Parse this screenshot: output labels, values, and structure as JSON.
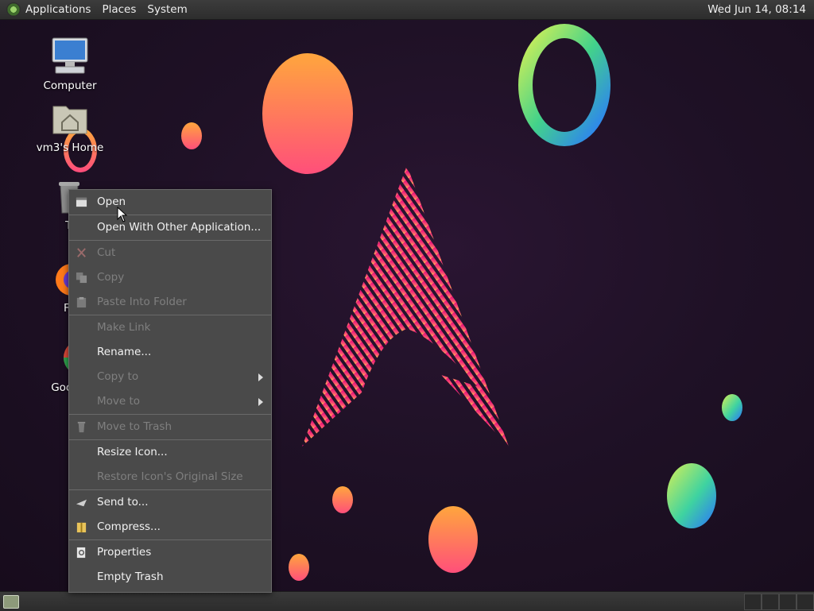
{
  "top_panel": {
    "menus": [
      "Applications",
      "Places",
      "System"
    ],
    "clock": "Wed Jun 14, 08:14"
  },
  "desktop_icons": [
    {
      "label": "Computer",
      "icon": "computer-icon"
    },
    {
      "label": "vm3's Home",
      "icon": "home-folder-icon"
    },
    {
      "label": "Trash",
      "icon": "trash-icon",
      "visible_label": "Tr"
    },
    {
      "label": "Firefox",
      "icon": "firefox-icon",
      "visible_label": "Fir"
    },
    {
      "label": "Google Chrome",
      "icon": "chrome-icon",
      "visible_label": "Google"
    }
  ],
  "context_menu": {
    "items": [
      {
        "label": "Open",
        "enabled": true,
        "icon": "open-icon"
      },
      {
        "label": "Open With Other Application...",
        "enabled": true
      },
      {
        "label": "Cut",
        "enabled": false,
        "icon": "cut-icon"
      },
      {
        "label": "Copy",
        "enabled": false,
        "icon": "copy-icon"
      },
      {
        "label": "Paste Into Folder",
        "enabled": false,
        "icon": "paste-icon"
      },
      {
        "label": "Make Link",
        "enabled": false
      },
      {
        "label": "Rename...",
        "enabled": true
      },
      {
        "label": "Copy to",
        "enabled": false,
        "submenu": true
      },
      {
        "label": "Move to",
        "enabled": false,
        "submenu": true
      },
      {
        "label": "Move to Trash",
        "enabled": false,
        "icon": "trash-icon"
      },
      {
        "label": "Resize Icon...",
        "enabled": true
      },
      {
        "label": "Restore Icon's Original Size",
        "enabled": false
      },
      {
        "label": "Send to...",
        "enabled": true,
        "icon": "send-icon"
      },
      {
        "label": "Compress...",
        "enabled": true,
        "icon": "archive-icon"
      },
      {
        "label": "Properties",
        "enabled": true,
        "icon": "properties-icon"
      },
      {
        "label": "Empty Trash",
        "enabled": true
      }
    ]
  },
  "colors": {
    "panel_bg": "#333333",
    "menu_bg": "#4a4a4a",
    "desktop_bg": "#1f1126",
    "accent_pink": "#e0206e",
    "accent_orange": "#ffa040"
  }
}
